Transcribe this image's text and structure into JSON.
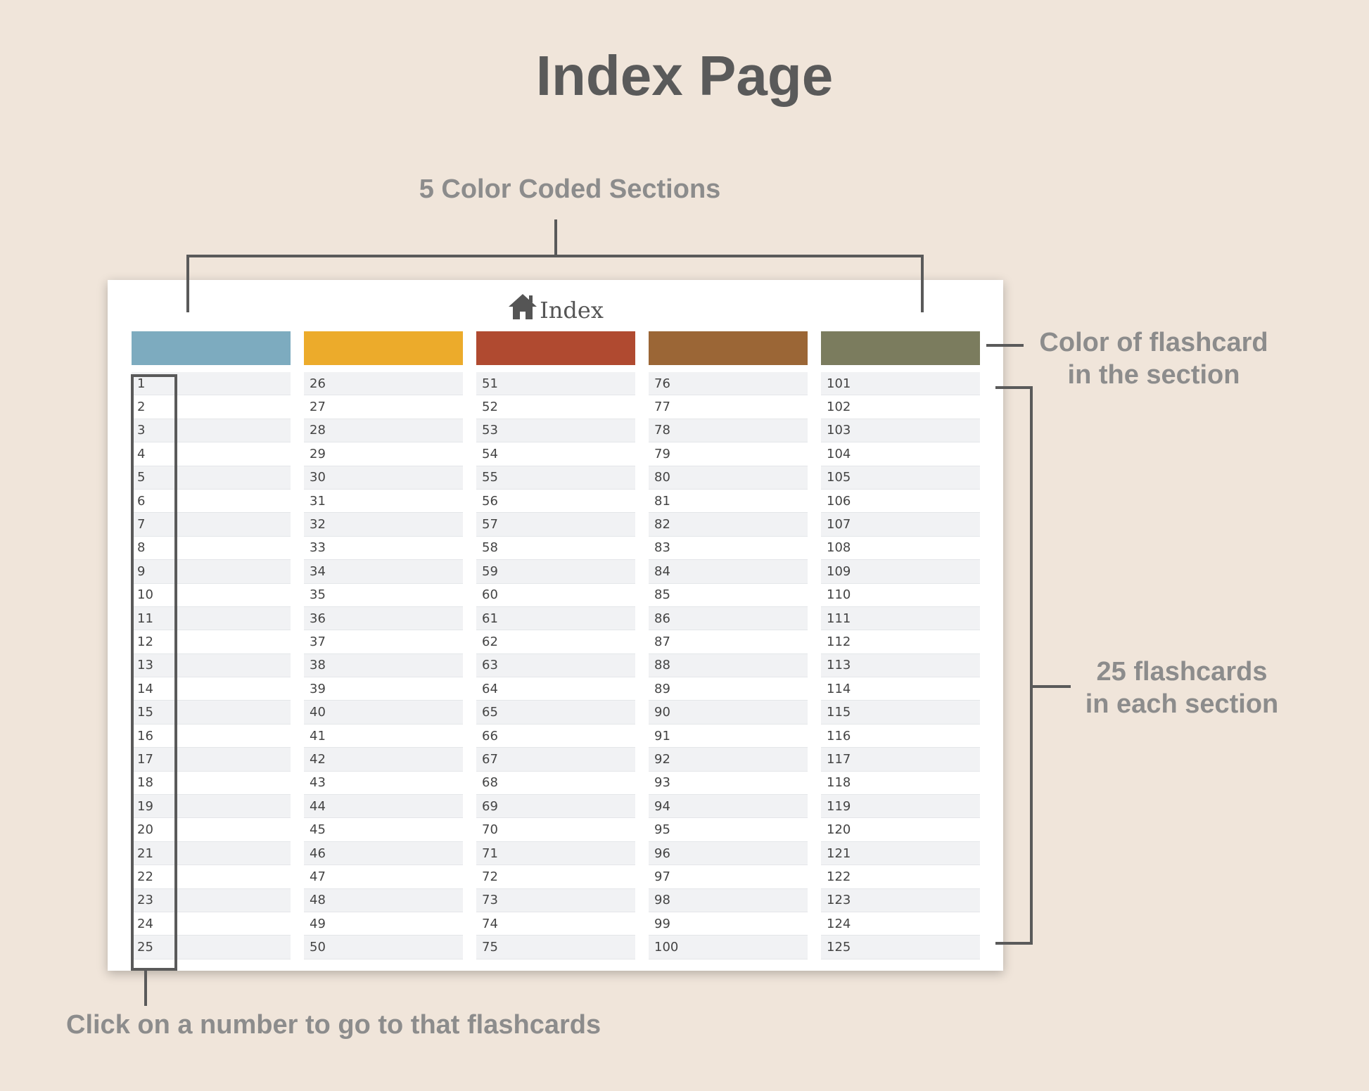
{
  "page_title": "Index Page",
  "annotations": {
    "sections": "5 Color Coded Sections",
    "color_line1": "Color of flashcard",
    "color_line2": "in the section",
    "count_line1": "25 flashcards",
    "count_line2": "in each section",
    "click": "Click on a number to go to that flashcards"
  },
  "card": {
    "title": "Index",
    "icon": "home-icon",
    "sections": [
      {
        "color": "#7dabbf",
        "start": 1
      },
      {
        "color": "#ecab2b",
        "start": 26
      },
      {
        "color": "#b04a30",
        "start": 51
      },
      {
        "color": "#9b6636",
        "start": 76
      },
      {
        "color": "#7b7c5e",
        "start": 101
      }
    ],
    "per_section": 25
  }
}
